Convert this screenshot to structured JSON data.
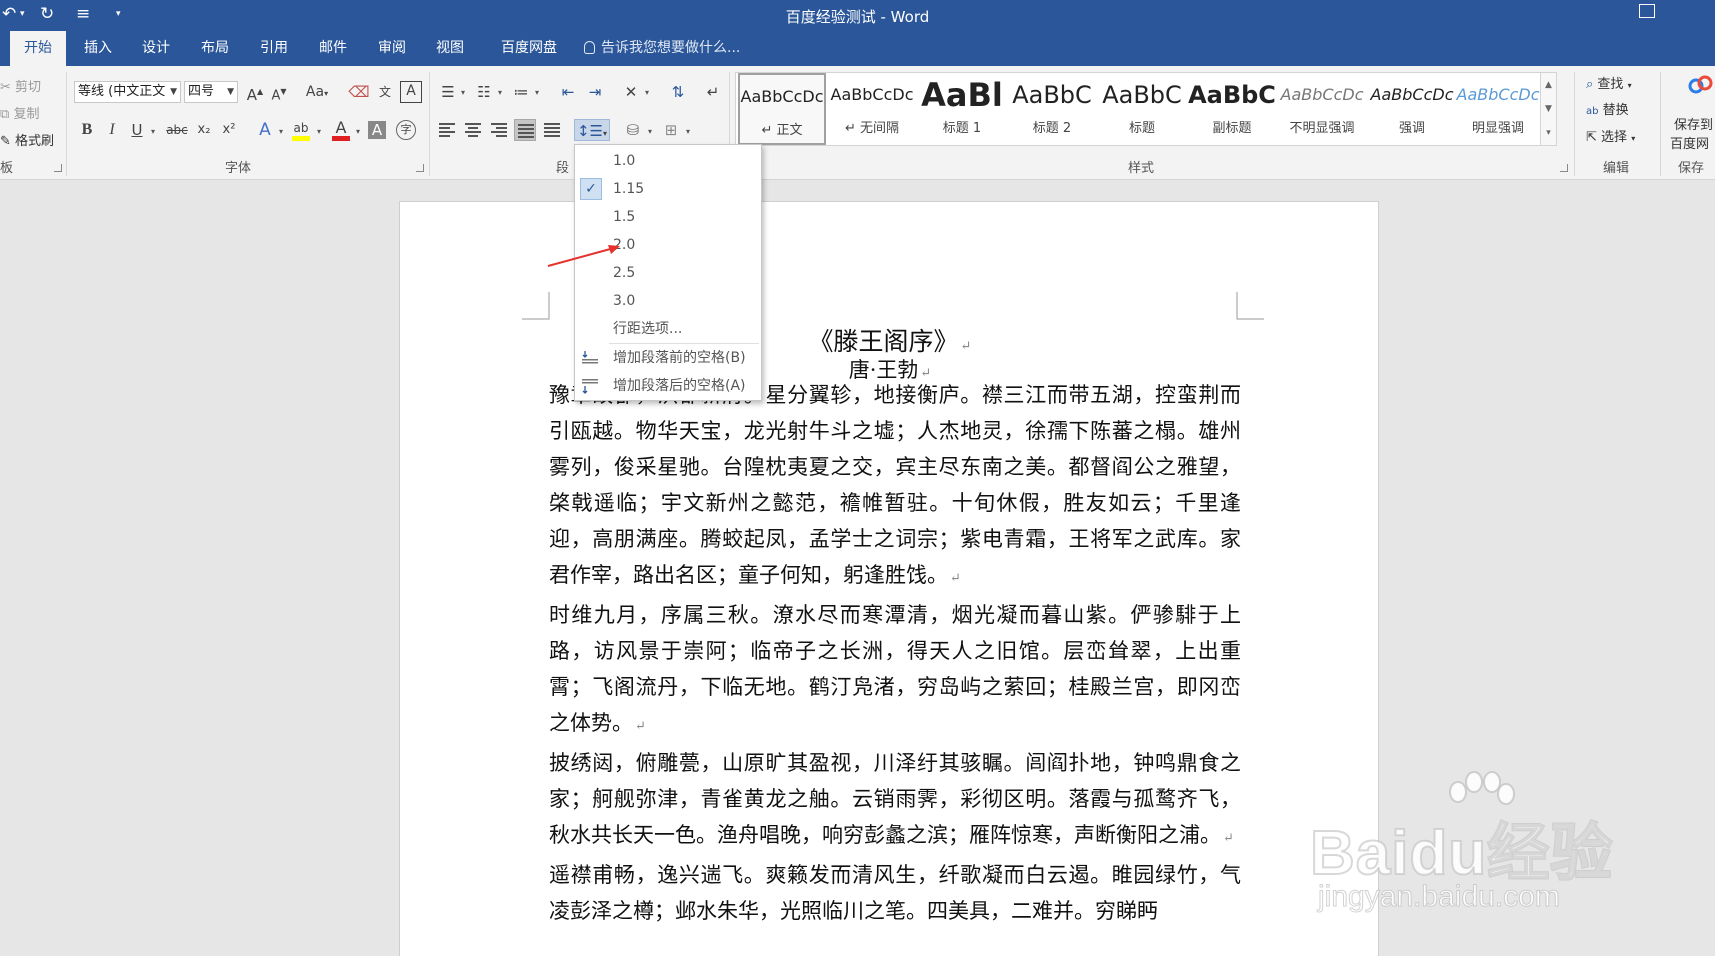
{
  "window": {
    "title": "百度经验测试 - Word"
  },
  "tabs": [
    "开始",
    "插入",
    "设计",
    "布局",
    "引用",
    "邮件",
    "审阅",
    "视图",
    "百度网盘"
  ],
  "tell_me": "告诉我您想要做什么...",
  "clipboard": {
    "cut": "剪切",
    "copy": "复制",
    "format_painter": "格式刷",
    "label": "板"
  },
  "font": {
    "name": "等线 (中文正文",
    "size": "四号",
    "label": "字体",
    "grow": "A",
    "shrink": "A",
    "case": "Aa",
    "bold": "B",
    "italic": "I",
    "underline": "U",
    "strike": "abc",
    "subscript": "x₂",
    "superscript": "x²",
    "highlight_color": "#ffff00",
    "font_color": "#e02020"
  },
  "paragraph": {
    "label": "段"
  },
  "styles": {
    "label": "样式",
    "items": [
      {
        "sample": "AaBbCcDc",
        "name": "↵ 正文"
      },
      {
        "sample": "AaBbCcDc",
        "name": "↵ 无间隔"
      },
      {
        "sample": "AaBl",
        "name": "标题 1"
      },
      {
        "sample": "AaBbC",
        "name": "标题 2"
      },
      {
        "sample": "AaBbC",
        "name": "标题"
      },
      {
        "sample": "AaBbC",
        "name": "副标题"
      },
      {
        "sample": "AaBbCcDc",
        "name": "不明显强调"
      },
      {
        "sample": "AaBbCcDc",
        "name": "强调"
      },
      {
        "sample": "AaBbCcDc",
        "name": "明显强调"
      }
    ]
  },
  "editing": {
    "find": "查找",
    "replace": "替换",
    "select": "选择",
    "label": "编辑"
  },
  "save_baidu": {
    "line1": "保存到",
    "line2": "百度网",
    "label": "保存"
  },
  "line_spacing_menu": {
    "options": [
      "1.0",
      "1.15",
      "1.5",
      "2.0",
      "2.5",
      "3.0"
    ],
    "selected": "1.15",
    "more": "行距选项...",
    "add_before": "增加段落前的空格(B)",
    "add_after": "增加段落后的空格(A)"
  },
  "document": {
    "title": "《滕王阁序》",
    "author": "唐·王勃",
    "paragraphs": [
      "豫章故郡，洪都新府。星分翼轸，地接衡庐。襟三江而带五湖，控蛮荆而引瓯越。物华天宝，龙光射牛斗之墟；人杰地灵，徐孺下陈蕃之榻。雄州雾列，俊采星驰。台隍枕夷夏之交，宾主尽东南之美。都督阎公之雅望，棨戟遥临；宇文新州之懿范，襜帷暂驻。十旬休假，胜友如云；千里逢迎，高朋满座。腾蛟起凤，孟学士之词宗；紫电青霜，王将军之武库。家君作宰，路出名区；童子何知，躬逢胜饯。",
      "时维九月，序属三秋。潦水尽而寒潭清，烟光凝而暮山紫。俨骖騑于上路，访风景于崇阿；临帝子之长洲，得天人之旧馆。层峦耸翠，上出重霄；飞阁流丹，下临无地。鹤汀凫渚，穷岛屿之萦回；桂殿兰宫，即冈峦之体势。",
      "披绣闼，俯雕甍，山原旷其盈视，川泽纡其骇瞩。闾阎扑地，钟鸣鼎食之家；舸舰弥津，青雀黄龙之舳。云销雨霁，彩彻区明。落霞与孤鹜齐飞，秋水共长天一色。渔舟唱晚，响穷彭蠡之滨；雁阵惊寒，声断衡阳之浦。",
      "遥襟甫畅，逸兴遄飞。爽籁发而清风生，纤歌凝而白云遏。睢园绿竹，气凌彭泽之樽；邺水朱华，光照临川之笔。四美具，二难并。穷睇眄"
    ]
  },
  "watermark": {
    "brand": "Baidu经验",
    "url": "jingyan.baidu.com"
  }
}
